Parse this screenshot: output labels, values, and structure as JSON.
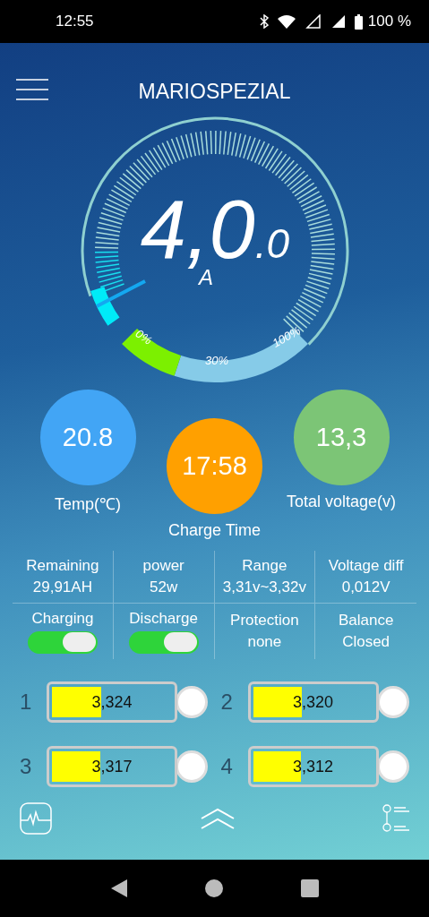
{
  "status_bar": {
    "time": "12:55",
    "battery": "100 %"
  },
  "header": {
    "title": "MARIOSPEZIAL"
  },
  "gauge": {
    "value": "4,0",
    "decimal": ".0",
    "unit": "A",
    "scale_labels": [
      "0%",
      "30%",
      "100%"
    ]
  },
  "stats": [
    {
      "label": "Temp(℃)",
      "value": "20.8",
      "color": "#42a5f5"
    },
    {
      "label": "Charge Time",
      "value": "17:58",
      "color": "#ffa000"
    },
    {
      "label": "Total voltage(v)",
      "value": "13,3",
      "color": "#7cc576"
    }
  ],
  "info": [
    {
      "label": "Remaining",
      "value": "29,91AH"
    },
    {
      "label": "power",
      "value": "52w"
    },
    {
      "label": "Range",
      "value": "3,31v~3,32v"
    },
    {
      "label": "Voltage diff",
      "value": "0,012V"
    }
  ],
  "controls": [
    {
      "kind": "switch",
      "label": "Charging",
      "on": true
    },
    {
      "kind": "switch",
      "label": "Discharge",
      "on": true
    },
    {
      "kind": "text",
      "label": "Protection",
      "value": "none"
    },
    {
      "kind": "text",
      "label": "Balance",
      "value": "Closed"
    }
  ],
  "cells": [
    {
      "index": "1",
      "reading": "3,324",
      "level": 0.41
    },
    {
      "index": "2",
      "reading": "3,320",
      "level": 0.41
    },
    {
      "index": "3",
      "reading": "3,317",
      "level": 0.4
    },
    {
      "index": "4",
      "reading": "3,312",
      "level": 0.4
    }
  ]
}
